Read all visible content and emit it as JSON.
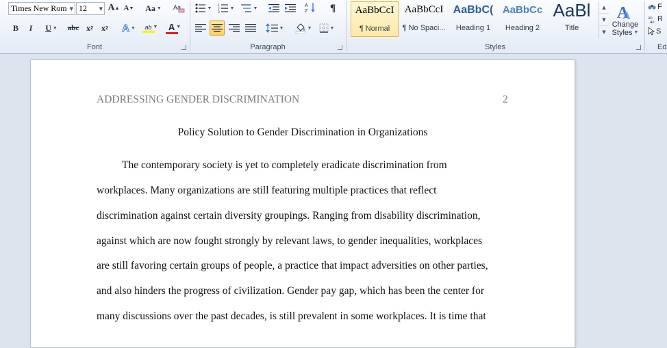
{
  "ribbon": {
    "font": {
      "label": "Font",
      "font_name": "Times New Rom",
      "font_size": "12",
      "grow_label": "A",
      "shrink_label": "A",
      "case_label": "Aa",
      "bold": "B",
      "italic": "I",
      "underline": "U",
      "strike": "abc",
      "subscript": "x",
      "subscript_mark": "2",
      "superscript": "x",
      "superscript_mark": "2",
      "effects_label": "A",
      "highlight_label": "ab",
      "font_color_label": "A",
      "highlight_color": "#f7f200",
      "font_color": "#e02020"
    },
    "paragraph": {
      "label": "Paragraph",
      "pilcrow": "¶",
      "sort_label": "A Z"
    },
    "styles": {
      "label": "Styles",
      "items": [
        {
          "preview": "AaBbCcI",
          "name": "¶ Normal"
        },
        {
          "preview": "AaBbCcI",
          "name": "¶ No Spaci..."
        },
        {
          "preview": "AaBbC(",
          "name": "Heading 1"
        },
        {
          "preview": "AaBbCc",
          "name": "Heading 2"
        },
        {
          "preview": "AaBl",
          "name": "Title"
        }
      ],
      "change_styles_line1": "Change",
      "change_styles_line2": "Styles"
    },
    "editing": {
      "label": "Editi",
      "find_label": "F",
      "replace_label": "R",
      "select_label": "S"
    }
  },
  "document": {
    "running_head": "ADDRESSING GENDER DISCRIMINATION",
    "page_number": "2",
    "title": "Policy Solution to Gender Discrimination in Organizations",
    "lines": [
      "The contemporary society is yet to completely eradicate discrimination from",
      "workplaces. Many organizations are still featuring multiple practices that reflect",
      "discrimination against certain diversity groupings. Ranging from disability discrimination,",
      "against which are now fought strongly by relevant laws, to gender inequalities, workplaces",
      "are still favoring certain groups of people, a practice that impact adversities on other parties,",
      "and also hinders the progress of civilization. Gender pay gap, which has been the center for",
      "many discussions over the past decades, is still prevalent in some workplaces. It is time that"
    ]
  }
}
